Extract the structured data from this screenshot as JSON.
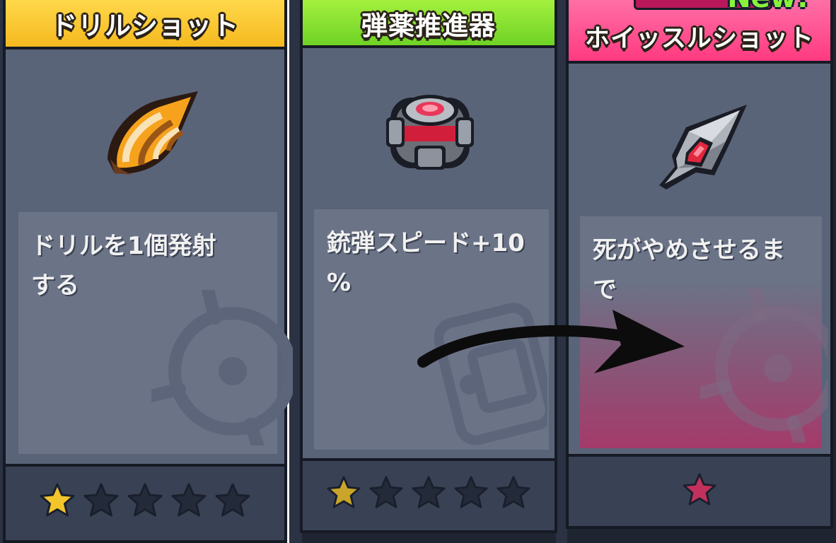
{
  "cards": [
    {
      "title": "ドリルショット",
      "description_lines": [
        "ドリルを1個発射",
        "する"
      ],
      "icon": "drill-icon",
      "header_color": "#f8c62c",
      "stars_filled": 1,
      "stars_total": 5
    },
    {
      "title": "弾薬推進器",
      "description_lines": [
        "銃弾スピード+10",
        "%"
      ],
      "icon": "ammo-thruster-icon",
      "header_color": "#7fde2e",
      "stars_filled": 1,
      "stars_total": 5
    },
    {
      "title": "ホイッスルショット",
      "description_lines": [
        "死がやめさせるま",
        "で"
      ],
      "icon": "whistle-shot-icon",
      "header_color": "#ff4d8f",
      "badge": "New!",
      "stars_filled": 1,
      "stars_total": 1
    }
  ],
  "colors": {
    "star_gold": "#f2c52a",
    "star_empty": "#232b3b",
    "star_pink": "#c2305e"
  }
}
